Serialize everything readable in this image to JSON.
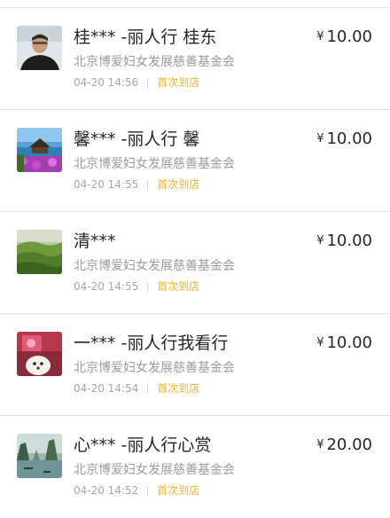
{
  "currency_symbol": "¥",
  "colors": {
    "badge": "#f5b21a",
    "divider": "#e3e3e3",
    "secondary_text": "#9b9b9b"
  },
  "donations": [
    {
      "avatar_icon": "portrait-photo",
      "name": "桂*** -丽人行 桂东",
      "amount": "10.00",
      "organization": "北京博爱妇女发展慈善基金会",
      "time": "04-20 14:56",
      "badge": "首次到店"
    },
    {
      "avatar_icon": "resort-pavilion-photo",
      "name": "馨*** -丽人行 馨",
      "amount": "10.00",
      "organization": "北京博爱妇女发展慈善基金会",
      "time": "04-20 14:55",
      "badge": "首次到店"
    },
    {
      "avatar_icon": "green-hills-photo",
      "name": "清***",
      "amount": "10.00",
      "organization": "北京博爱妇女发展慈善基金会",
      "time": "04-20 14:55",
      "badge": "首次到店"
    },
    {
      "avatar_icon": "pet-dog-photo",
      "name": "一*** -丽人行我看行",
      "amount": "10.00",
      "organization": "北京博爱妇女发展慈善基金会",
      "time": "04-20 14:54",
      "badge": "首次到店"
    },
    {
      "avatar_icon": "karst-bay-photo",
      "name": "心*** -丽人行心赏",
      "amount": "20.00",
      "organization": "北京博爱妇女发展慈善基金会",
      "time": "04-20 14:52",
      "badge": "首次到店"
    }
  ]
}
